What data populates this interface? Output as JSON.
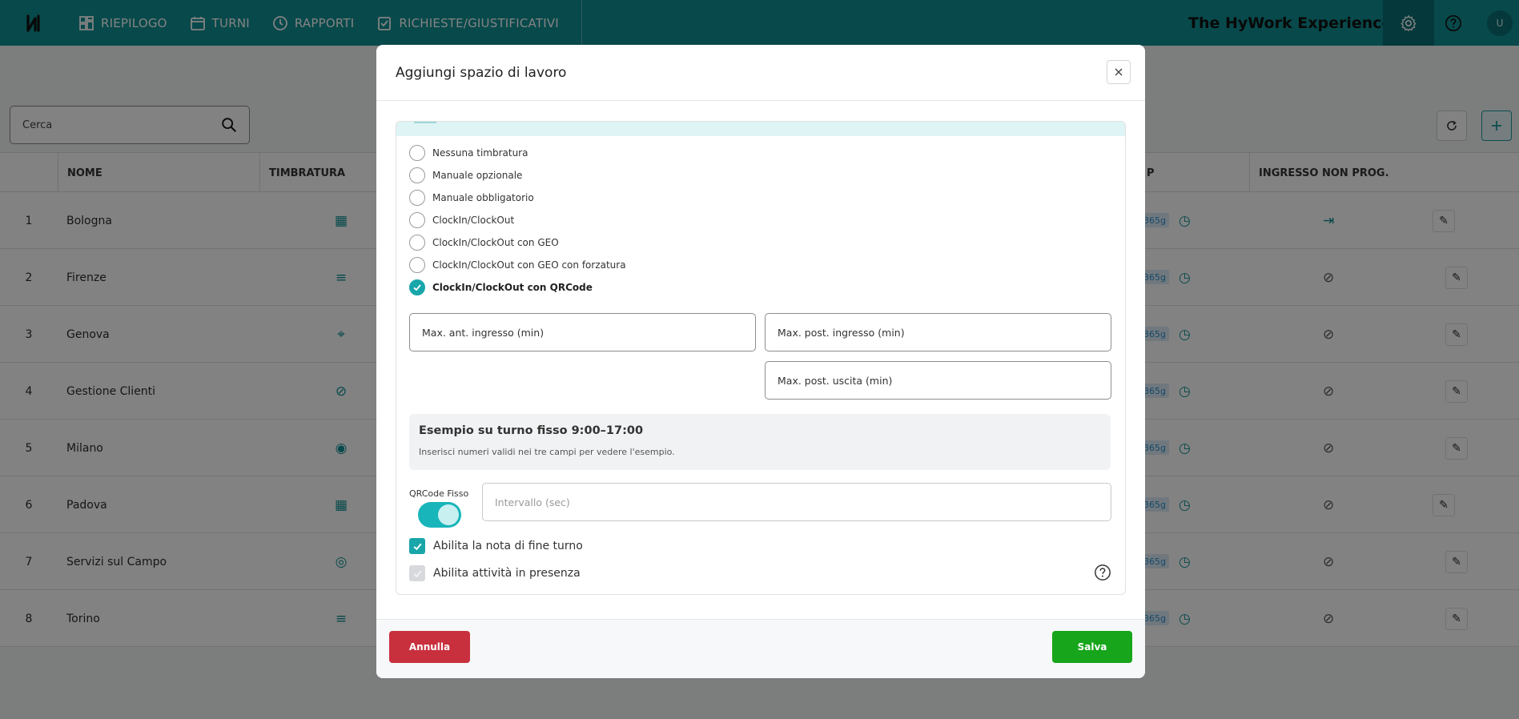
{
  "nav": {
    "items": [
      {
        "label": "RIEPILOGO",
        "icon": "dashboard-icon"
      },
      {
        "label": "TURNI",
        "icon": "calendar-icon"
      },
      {
        "label": "RAPPORTI",
        "icon": "clock-icon"
      },
      {
        "label": "RICHIESTE/GIUSTIFICATIVI",
        "icon": "checklist-icon"
      }
    ],
    "brand": "The HyWork Experience",
    "avatar": "U"
  },
  "background": {
    "search_placeholder": "Cerca",
    "columns": {
      "nome": "NOME",
      "timbratura": "TIMBRATURA",
      "p": "P",
      "ingresso": "INGRESSO NON PROG."
    },
    "rows": [
      {
        "idx": "1",
        "name": "Bologna",
        "timbratura_icon": "qrcode-icon",
        "badge": "365g",
        "ingresso_icon": "login-icon"
      },
      {
        "idx": "2",
        "name": "Firenze",
        "timbratura_icon": "note-icon",
        "badge": "365g",
        "ingresso_icon": "forbidden-icon"
      },
      {
        "idx": "3",
        "name": "Genova",
        "timbratura_icon": "location-icon",
        "badge": "365g",
        "ingresso_icon": "forbidden-icon"
      },
      {
        "idx": "4",
        "name": "Gestione Clienti",
        "timbratura_icon": "forbidden-icon",
        "badge": "365g",
        "ingresso_icon": "forbidden-icon"
      },
      {
        "idx": "5",
        "name": "Milano",
        "timbratura_icon": "fingerprint-icon",
        "badge": "365g",
        "ingresso_icon": "forbidden-icon"
      },
      {
        "idx": "6",
        "name": "Padova",
        "timbratura_icon": "qrcode-icon",
        "badge": "365g",
        "ingresso_icon": "forbidden-icon"
      },
      {
        "idx": "7",
        "name": "Servizi sul Campo",
        "timbratura_icon": "target-icon",
        "badge": "365g",
        "ingresso_icon": "forbidden-icon"
      },
      {
        "idx": "8",
        "name": "Torino",
        "timbratura_icon": "note-star-icon",
        "badge": "365g",
        "ingresso_icon": "forbidden-icon"
      }
    ]
  },
  "modal": {
    "title": "Aggiungi spazio di lavoro",
    "radio_options": [
      {
        "label": "Nessuna timbratura",
        "checked": false
      },
      {
        "label": "Manuale opzionale",
        "checked": false
      },
      {
        "label": "Manuale obbligatorio",
        "checked": false
      },
      {
        "label": "ClockIn/ClockOut",
        "checked": false
      },
      {
        "label": "ClockIn/ClockOut con GEO",
        "checked": false
      },
      {
        "label": "ClockIn/ClockOut con GEO con forzatura",
        "checked": false
      },
      {
        "label": "ClockIn/ClockOut con QRCode",
        "checked": true
      }
    ],
    "fields": {
      "max_ant_ingresso": "Max. ant. ingresso (min)",
      "max_post_ingresso": "Max. post. ingresso (min)",
      "max_post_uscita": "Max. post. uscita (min)"
    },
    "example": {
      "title": "Esempio su turno fisso 9:00–17:00",
      "subtitle": "Inserisci numeri validi nei tre campi per vedere l'esempio."
    },
    "qrcode_fisso_label": "QRCode Fisso",
    "qrcode_fisso_on": true,
    "interval_placeholder": "Intervallo (sec)",
    "checkbox_nota": "Abilita la nota di fine turno",
    "checkbox_nota_checked": true,
    "checkbox_attivita": "Abilita attività in presenza",
    "checkbox_attivita_checked": true,
    "cancel_label": "Annulla",
    "save_label": "Salva"
  },
  "colors": {
    "primary": "#118f93",
    "accent": "#18a6ab",
    "cancel": "#c9303e",
    "save": "#17a51b"
  }
}
